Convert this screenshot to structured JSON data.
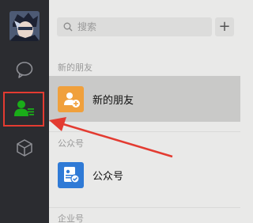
{
  "sidebar": {
    "nav": [
      {
        "icon": "chat-bubble-icon",
        "active": false
      },
      {
        "icon": "contacts-icon",
        "active": true
      },
      {
        "icon": "favorites-cube-icon",
        "active": false
      }
    ]
  },
  "search": {
    "placeholder": "搜索"
  },
  "add_button": {
    "label": "+"
  },
  "sections": {
    "new_friends": {
      "header": "新的朋友",
      "item_label": "新的朋友",
      "icon": "add-friend-icon",
      "icon_color": "#f0a03c"
    },
    "official_accounts": {
      "header": "公众号",
      "item_label": "公众号",
      "icon": "official-account-icon",
      "icon_color": "#2f7ad6"
    },
    "enterprise": {
      "header": "企业号"
    }
  },
  "colors": {
    "sidebar_bg": "#2b2c30",
    "active_green": "#1aad19",
    "highlight_red": "#e33b31",
    "panel_bg": "#e9e9e8",
    "selected_row": "#c9c9c8"
  }
}
